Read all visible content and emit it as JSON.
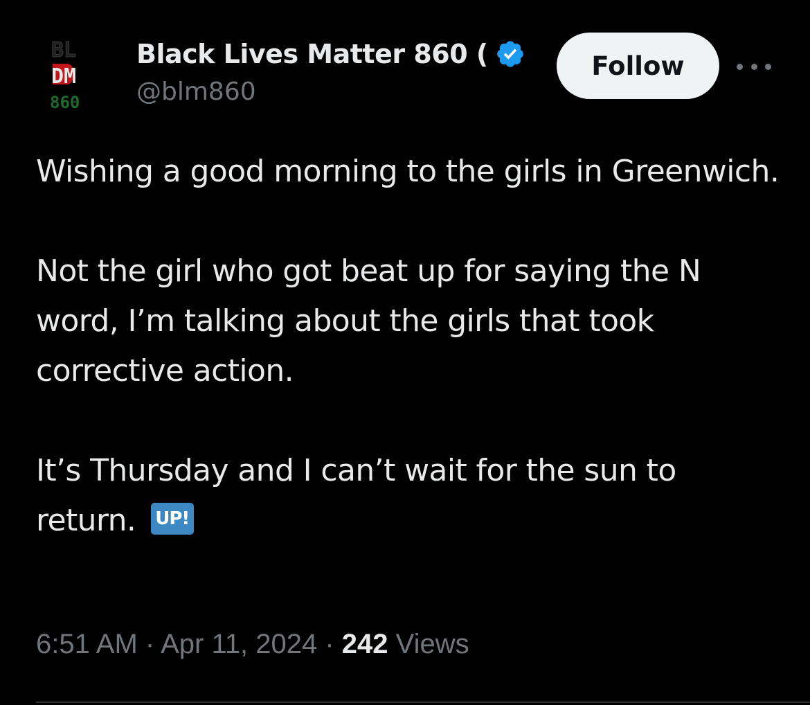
{
  "account": {
    "display_name": "Black Lives Matter 860 (",
    "handle": "@blm860",
    "verified": true,
    "avatar_text": {
      "line1": "BL",
      "line2": "DM",
      "line3": "860"
    }
  },
  "actions": {
    "follow_label": "Follow"
  },
  "tweet": {
    "paragraphs": [
      "Wishing a good morning to the girls in Greenwich.",
      "Not the girl who got beat up for saying the N word, I’m talking about the girls that took corrective action.",
      "It’s Thursday and I can’t wait for the sun to return."
    ],
    "emoji": "UP!"
  },
  "meta": {
    "time": "6:51 AM",
    "separator": "·",
    "date": "Apr 11, 2024",
    "views_count": "242",
    "views_label": "Views"
  },
  "colors": {
    "background": "#000000",
    "text": "#e7e9ea",
    "secondary_text": "#71767b",
    "verified_badge": "#1d9bf0",
    "follow_button_bg": "#eff3f4",
    "emoji_bg": "#3b88c3",
    "divider": "#2f3336"
  }
}
